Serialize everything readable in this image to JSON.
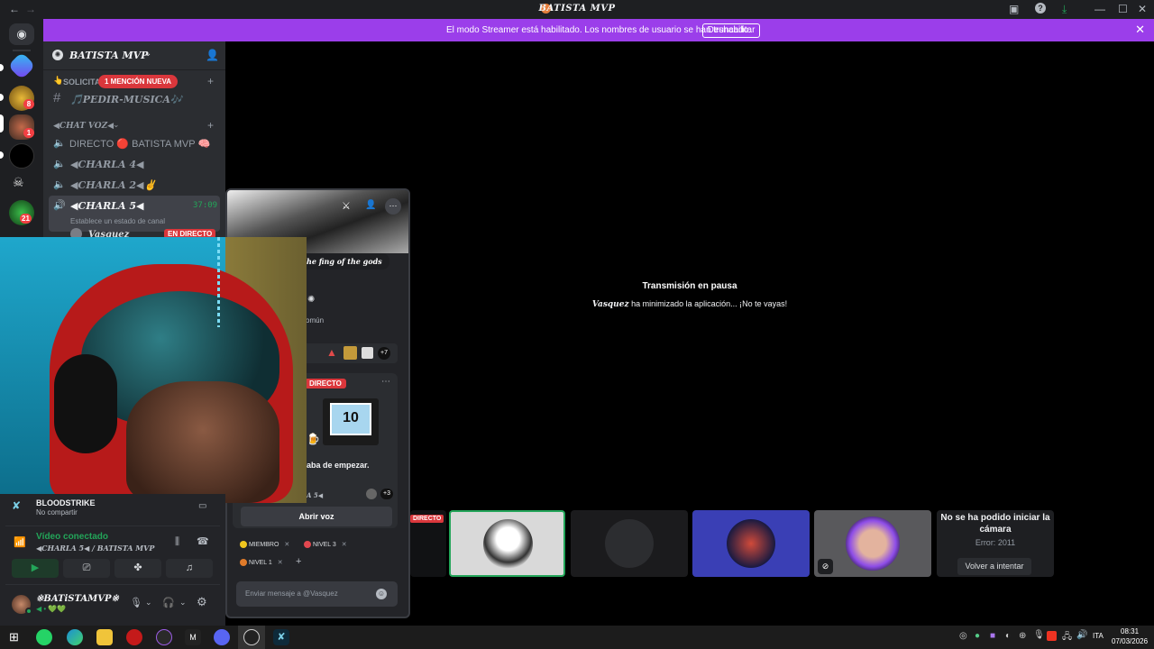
{
  "titlebar": {
    "title": "BATISTA MVP"
  },
  "banner": {
    "message": "El modo Streamer está habilitado. Los nombres de usuario se han truncado.",
    "disable_label": "Deshabilitar"
  },
  "server": {
    "name": "BATISTA MVP"
  },
  "rail_badges": {
    "b1": "8",
    "b2": "1",
    "b3": "21"
  },
  "channels": {
    "cat1": "SOLICITA",
    "mention_pill": "1 MENCIÓN NUEVA",
    "pedir_musica": "🎵PEDIR-MUSICA🎶",
    "cat2": "◀CHAT VOZ◀",
    "directo": "DIRECTO 🔴 BATISTA MVP 🧠",
    "charla4": "◀CHARLA 4◀",
    "charla2": "◀CHARLA 2◀✌",
    "charla5": "◀CHARLA 5◀",
    "charla5_time": "37:09",
    "charla5_status": "Establece un estado de canal",
    "live_user": "Vasquez",
    "live_badge": "EN DIRECTO"
  },
  "stage": {
    "paused_title": "Transmisión en pausa",
    "paused_user": "Vasquez",
    "paused_msg": "ha minimizado la aplicación... ¡No te vayas!",
    "live_badge": "DIRECTO",
    "cam_error_title": "No se ha podido iniciar la cámara",
    "cam_error_code": "Error: 2011",
    "retry_label": "Volver a intentar"
  },
  "card": {
    "bio": "he fing of the gods",
    "common": "omún",
    "more_count": "+7",
    "live_label": "DIRECTO",
    "screen_number": "10",
    "activity_text": "aba de empezar.",
    "activity_channel": "A 5◀",
    "extra_count": "+3",
    "open_voice": "Abrir voz",
    "roles": [
      "MIEMBRO",
      "NIVEL 3",
      "NIVEL 1"
    ],
    "role_colors": [
      "#f0c61e",
      "#e2474f",
      "#e07b2a"
    ],
    "message_placeholder": "Enviar mensaje a @Vasquez"
  },
  "userpanel": {
    "stream_game": "BLOODSTRIKE",
    "stream_status": "No compartir",
    "voice_status": "Vídeo conectado",
    "voice_channel": "◀CHARLA 5◀ / BATISTA MVP",
    "username": "※BATiSTAMVP※",
    "user_sub": "◀ • 💚💚"
  },
  "taskbar": {
    "lang": "ITA",
    "time": "08:31",
    "date": "07/03/2026"
  },
  "colors": {
    "blurple": "#5865f2",
    "green": "#23a559",
    "red": "#da373c",
    "purple_banner": "#9b3eea"
  }
}
